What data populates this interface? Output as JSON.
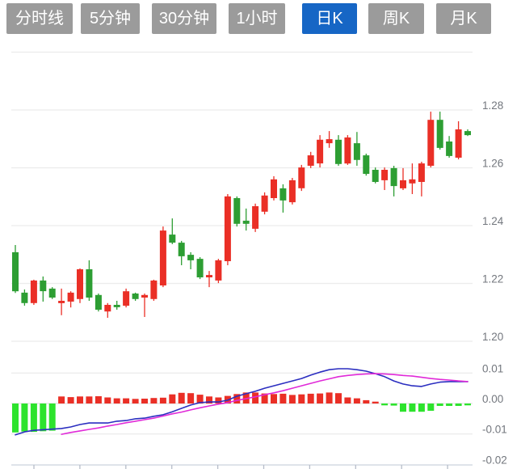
{
  "tabs": {
    "items": [
      {
        "label": "分时线",
        "active": false
      },
      {
        "label": "5分钟",
        "active": false
      },
      {
        "label": "30分钟",
        "active": false
      },
      {
        "label": "1小时",
        "active": false
      },
      {
        "label": "日K",
        "active": true
      },
      {
        "label": "周K",
        "active": false
      },
      {
        "label": "月K",
        "active": false
      }
    ],
    "active_color": "#1666c5",
    "inactive_color": "#9b9b9b",
    "text_color": "#ffffff"
  },
  "chart_data": {
    "type": "candlestick+macd",
    "price_panel": {
      "grid_values": [
        1.3,
        1.28,
        1.26,
        1.24,
        1.22,
        1.2
      ],
      "y_axis_labels": [
        "1.28",
        "1.26",
        "1.24",
        "1.22",
        "1.20"
      ],
      "y_axis_values": [
        1.28,
        1.26,
        1.24,
        1.22,
        1.2
      ],
      "axis_range": [
        1.195,
        1.302
      ],
      "up_color": "#ea2f26",
      "down_color": "#2d9e33",
      "candles": [
        [
          1.2308,
          1.2333,
          1.2167,
          1.2173
        ],
        [
          1.2168,
          1.2179,
          1.2123,
          1.2132
        ],
        [
          1.2132,
          1.2213,
          1.2126,
          1.221
        ],
        [
          1.221,
          1.2224,
          1.2137,
          1.2173
        ],
        [
          1.2182,
          1.2187,
          1.2146,
          1.2151
        ],
        [
          1.2132,
          1.2182,
          1.209,
          1.214
        ],
        [
          1.2137,
          1.2173,
          1.2117,
          1.2168
        ],
        [
          1.2146,
          1.2252,
          1.2132,
          1.2249
        ],
        [
          1.2249,
          1.228,
          1.214,
          1.2151
        ],
        [
          1.216,
          1.2165,
          1.2103,
          1.2109
        ],
        [
          1.2103,
          1.2132,
          1.2081,
          1.2126
        ],
        [
          1.2126,
          1.214,
          1.2109,
          1.2118
        ],
        [
          1.2123,
          1.2182,
          1.2117,
          1.2173
        ],
        [
          1.2165,
          1.2168,
          1.214,
          1.2146
        ],
        [
          1.2151,
          1.2165,
          1.2084,
          1.216
        ],
        [
          1.2146,
          1.2213,
          1.214,
          1.221
        ],
        [
          1.2193,
          1.2397,
          1.2187,
          1.2383
        ],
        [
          1.2369,
          1.2425,
          1.2336,
          1.2341
        ],
        [
          1.2341,
          1.2347,
          1.2263,
          1.2294
        ],
        [
          1.2299,
          1.2308,
          1.2249,
          1.228
        ],
        [
          1.2285,
          1.2291,
          1.2215,
          1.2221
        ],
        [
          1.2221,
          1.2243,
          1.2187,
          1.2229
        ],
        [
          1.221,
          1.2285,
          1.2201,
          1.228
        ],
        [
          1.2277,
          1.2509,
          1.2263,
          1.2501
        ],
        [
          1.2495,
          1.2501,
          1.2397,
          1.2406
        ],
        [
          1.2417,
          1.2459,
          1.2383,
          1.2406
        ],
        [
          1.2389,
          1.2476,
          1.2378,
          1.2467
        ],
        [
          1.2448,
          1.2515,
          1.2439,
          1.2504
        ],
        [
          1.2495,
          1.2571,
          1.2487,
          1.256
        ],
        [
          1.2529,
          1.2543,
          1.2445,
          1.2487
        ],
        [
          1.2481,
          1.2565,
          1.2473,
          1.2557
        ],
        [
          1.2529,
          1.261,
          1.252,
          1.2601
        ],
        [
          1.2607,
          1.2655,
          1.2599,
          1.2643
        ],
        [
          1.2615,
          1.2713,
          1.2601,
          1.2697
        ],
        [
          1.2685,
          1.2727,
          1.2669,
          1.2699
        ],
        [
          1.2697,
          1.2713,
          1.2607,
          1.2613
        ],
        [
          1.2615,
          1.2713,
          1.261,
          1.2705
        ],
        [
          1.2685,
          1.2724,
          1.2607,
          1.2627
        ],
        [
          1.2643,
          1.2649,
          1.2573,
          1.2579
        ],
        [
          1.2593,
          1.2601,
          1.2546,
          1.2551
        ],
        [
          1.2557,
          1.2601,
          1.2523,
          1.2593
        ],
        [
          1.2599,
          1.2607,
          1.2501,
          1.2537
        ],
        [
          1.2529,
          1.2599,
          1.2523,
          1.2557
        ],
        [
          1.2546,
          1.2615,
          1.2509,
          1.256
        ],
        [
          1.2551,
          1.2621,
          1.2501,
          1.2615
        ],
        [
          1.2607,
          1.2794,
          1.2601,
          1.2766
        ],
        [
          1.2766,
          1.2794,
          1.2663,
          1.2669
        ],
        [
          1.2691,
          1.271,
          1.2635,
          1.2641
        ],
        [
          1.2635,
          1.2761,
          1.2629,
          1.2733
        ],
        [
          1.2727,
          1.2733,
          1.271,
          1.2713
        ]
      ]
    },
    "macd_panel": {
      "grid_values": [
        0.01,
        -0.01
      ],
      "y_axis_labels": [
        "0.01",
        "0.00",
        "-0.01",
        "-0.02"
      ],
      "y_axis_values": [
        0.01,
        0.0,
        -0.01,
        -0.02
      ],
      "axis_range": [
        -0.021,
        0.012
      ],
      "hist_up_color": "#ea2f26",
      "hist_down_color": "#2de32d",
      "dif_color": "#2b2ec0",
      "dea_color": "#e02ad8",
      "histogram": [
        -0.0095,
        -0.0092,
        -0.0093,
        -0.0091,
        -0.0089,
        0.0023,
        0.0021,
        0.0023,
        0.0023,
        0.0024,
        0.002,
        0.0017,
        0.0017,
        0.0015,
        0.0016,
        0.0018,
        0.0019,
        0.003,
        0.0035,
        0.0034,
        0.0029,
        0.0023,
        0.002,
        0.0025,
        0.0031,
        0.0036,
        0.0036,
        0.0033,
        0.0031,
        0.0032,
        0.0028,
        0.003,
        0.0032,
        0.0033,
        0.0036,
        0.0034,
        0.002,
        0.0017,
        0.0011,
        0.0006,
        -0.0006,
        -0.0007,
        -0.0027,
        -0.0027,
        -0.0027,
        -0.0024,
        -0.0008,
        -0.0008,
        -0.0008,
        -0.0006
      ],
      "dif": [
        -0.0103,
        -0.0093,
        -0.0088,
        -0.0086,
        -0.0084,
        -0.0082,
        -0.0077,
        -0.0069,
        -0.0064,
        -0.0064,
        -0.0064,
        -0.0058,
        -0.0056,
        -0.005,
        -0.0048,
        -0.0042,
        -0.0037,
        -0.0027,
        -0.0016,
        -0.0005,
        0.0003,
        0.0005,
        0.0005,
        0.0011,
        0.0024,
        0.0032,
        0.004,
        0.005,
        0.0058,
        0.0066,
        0.0074,
        0.0082,
        0.0093,
        0.0103,
        0.0111,
        0.0114,
        0.0114,
        0.0111,
        0.0106,
        0.0098,
        0.0088,
        0.0074,
        0.0064,
        0.0058,
        0.0056,
        0.0064,
        0.007,
        0.0072,
        0.0072,
        0.0072
      ],
      "dea": [
        null,
        null,
        null,
        null,
        null,
        -0.0101,
        -0.0095,
        -0.009,
        -0.0085,
        -0.008,
        -0.0074,
        -0.0069,
        -0.0063,
        -0.0058,
        -0.0053,
        -0.0048,
        -0.0041,
        -0.0034,
        -0.0028,
        -0.0021,
        -0.0014,
        -0.0008,
        -0.0002,
        0.0003,
        0.001,
        0.0016,
        0.0022,
        0.0029,
        0.0035,
        0.0042,
        0.005,
        0.0058,
        0.0066,
        0.0074,
        0.0081,
        0.0088,
        0.0092,
        0.0095,
        0.0097,
        0.0098,
        0.0097,
        0.0095,
        0.0092,
        0.009,
        0.0086,
        0.0082,
        0.0079,
        0.0077,
        0.0074,
        0.0072
      ]
    },
    "layout_hints": {
      "grid": true,
      "legend": "none",
      "x_axis_labels": "none (tick marks only)"
    }
  }
}
